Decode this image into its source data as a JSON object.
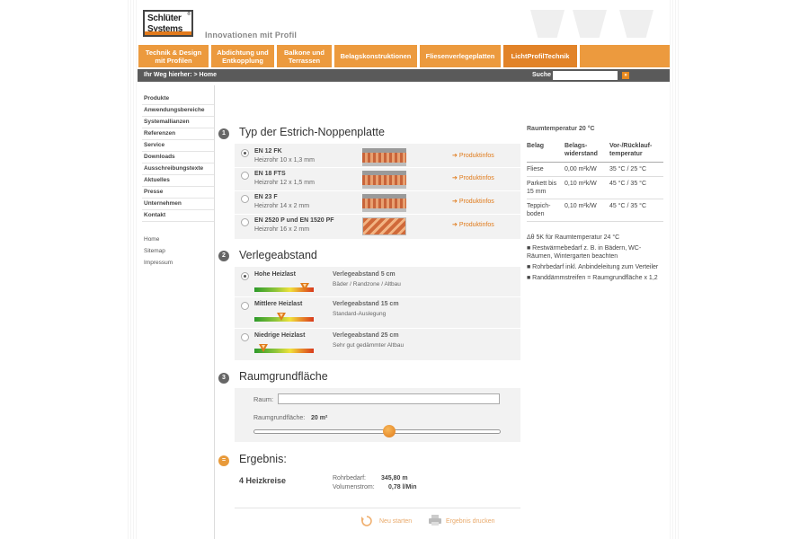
{
  "brand": {
    "line1": "Schlüter",
    "line2": "Systems",
    "reg": "®",
    "tagline": "Innovationen mit Profil"
  },
  "nav": [
    "Technik & Design mit Profilen",
    "Abdichtung und Entkopplung",
    "Balkone und Terrassen",
    "Belagskonstruktionen",
    "Fliesenverlegeplatten",
    "LichtProfilTechnik"
  ],
  "breadcrumb": {
    "text": "Ihr Weg hierher: > Home",
    "search_label": "Suche",
    "search_value": "",
    "go": "»"
  },
  "leftnav": {
    "primary": [
      "Produkte",
      "Anwendungsbereiche",
      "Systemallianzen",
      "Referenzen",
      "Service",
      "Downloads",
      "Ausschreibungstexte",
      "Aktuelles",
      "Presse",
      "Unternehmen",
      "Kontakt"
    ],
    "secondary": [
      "Home",
      "Sitemap",
      "Impressum"
    ]
  },
  "section1": {
    "num": "1",
    "title": "Typ der Estrich-Noppenplatte",
    "items": [
      {
        "name": "EN 12 FK",
        "sub": "Heizrohr 10 x 1,3 mm",
        "link": "Produktinfos",
        "selected": true
      },
      {
        "name": "EN 18 FTS",
        "sub": "Heizrohr 12 x 1,5 mm",
        "link": "Produktinfos",
        "selected": false
      },
      {
        "name": "EN 23 F",
        "sub": "Heizrohr 14 x 2 mm",
        "link": "Produktinfos",
        "selected": false
      },
      {
        "name": "EN 2520 P und EN 1520 PF",
        "sub": "Heizrohr 16 x 2 mm",
        "link": "Produktinfos",
        "selected": false
      }
    ]
  },
  "section2": {
    "num": "2",
    "title": "Verlegeabstand",
    "items": [
      {
        "name": "Hohe Heizlast",
        "dist": "Verlegeabstand 5 cm",
        "note": "Bäder / Randzone / Altbau",
        "level": 0.85,
        "selected": true
      },
      {
        "name": "Mittlere Heizlast",
        "dist": "Verlegeabstand 15 cm",
        "note": "Standard-Auslegung",
        "level": 0.45,
        "selected": false
      },
      {
        "name": "Niedrige Heizlast",
        "dist": "Verlegeabstand 25 cm",
        "note": "Sehr gut gedämmter Altbau",
        "level": 0.15,
        "selected": false
      }
    ]
  },
  "section3": {
    "num": "3",
    "title": "Raumgrundfläche",
    "room_label": "Raum:",
    "room_value": "",
    "area_label": "Raumgrundfläche:",
    "area_value": "20 m²",
    "slider": 0.55
  },
  "result": {
    "num": "=",
    "title": "Ergebnis:",
    "circuits": "4 Heizkreise",
    "rows": [
      {
        "label": "Rohrbedarf:",
        "value": "345,80 m"
      },
      {
        "label": "Volumenstrom:",
        "value": "0,78 l/Min"
      }
    ]
  },
  "footer": {
    "restart": "Neu starten",
    "print": "Ergebnis drucken"
  },
  "right": {
    "title": "Raumtemperatur 20 °C",
    "headers": [
      "Belag",
      "Belags-widerstand",
      "Vor-/Rücklauf-temperatur"
    ],
    "rows": [
      [
        "Fliese",
        "0,00 m²k/W",
        "35 °C / 25 °C"
      ],
      [
        "Parkett bis 15 mm",
        "0,10 m²k/W",
        "45 °C / 35 °C"
      ],
      [
        "Teppich-boden",
        "0,10 m²k/W",
        "45 °C / 35 °C"
      ]
    ],
    "notes": [
      "Δθ 5K für Raumtemperatur 24 °C",
      "■ Restwärmebedarf z. B. in Bädern, WC-Räumen, Wintergarten beachten",
      "■ Rohrbedarf inkl. Anbindeleitung zum Verteiler",
      "■ Randdämmstreifen = Raumgrundfläche x 1,2"
    ]
  },
  "colors": {
    "accent": "#ec9a3e",
    "accent_dark": "#e28328",
    "breadcrumb_bg": "#5a5a5a",
    "link": "#e07a1a"
  }
}
